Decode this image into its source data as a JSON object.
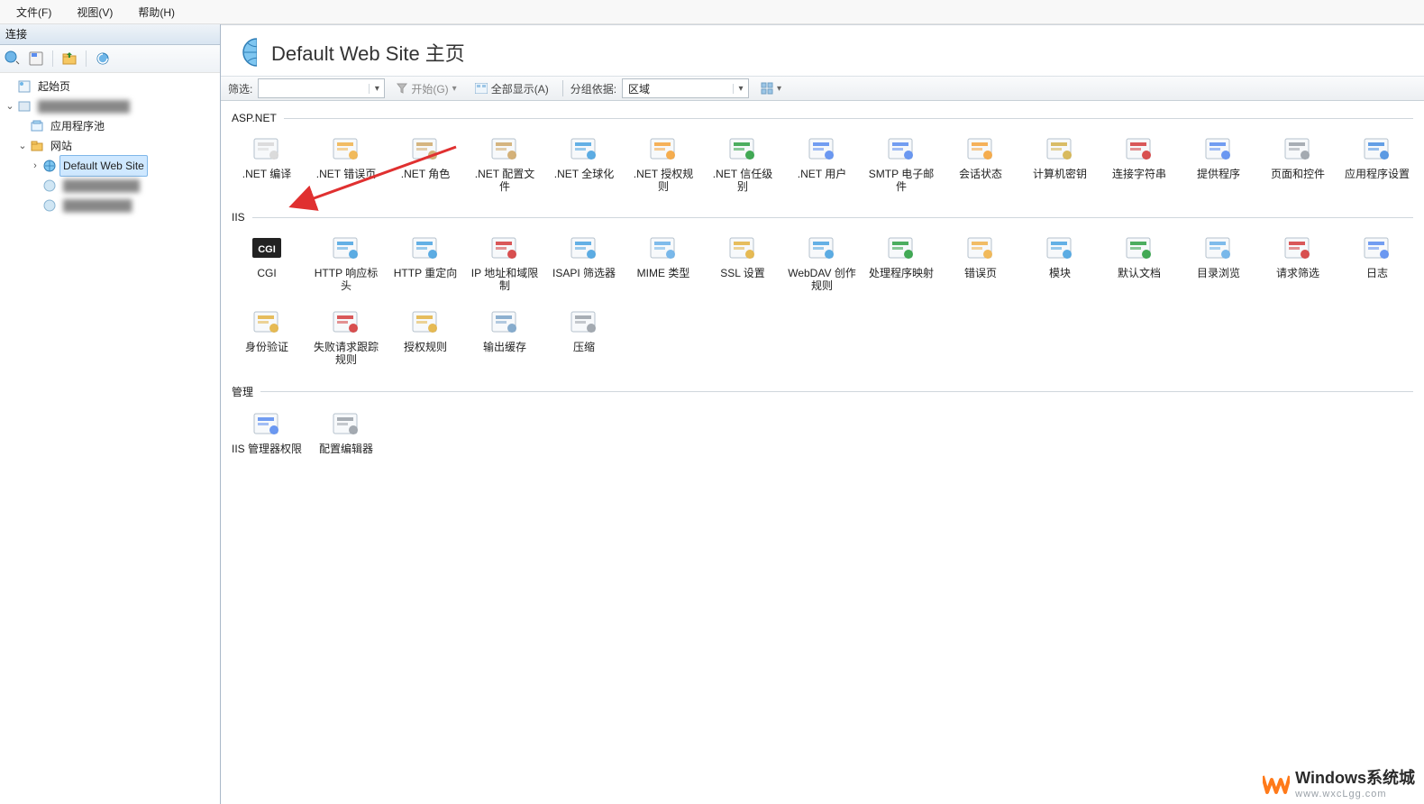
{
  "menubar": {
    "file": "文件(F)",
    "view": "视图(V)",
    "help": "帮助(H)"
  },
  "sidebar": {
    "title": "连接",
    "nodes": {
      "home": "起始页",
      "server": "████████████",
      "apppools": "应用程序池",
      "sites": "网站",
      "default_site": "Default Web Site",
      "sub1": "██████████",
      "sub2": "█████████"
    }
  },
  "page": {
    "title": "Default Web Site 主页"
  },
  "filterbar": {
    "filter_label": "筛选:",
    "go": "开始(G)",
    "showall": "全部显示(A)",
    "groupby_label": "分组依据:",
    "groupby_value": "区域"
  },
  "groups": {
    "aspnet": "ASP.NET",
    "iis": "IIS",
    "mgmt": "管理"
  },
  "aspnet_items": [
    ".NET 编译",
    ".NET 错误页",
    ".NET 角色",
    ".NET 配置文件",
    ".NET 全球化",
    ".NET 授权规则",
    ".NET 信任级别",
    ".NET 用户",
    "SMTP 电子邮件",
    "会话状态",
    "计算机密钥",
    "连接字符串",
    "提供程序",
    "页面和控件",
    "应用程序设置"
  ],
  "iis_items": [
    "CGI",
    "HTTP 响应标头",
    "HTTP 重定向",
    "IP 地址和域限制",
    "ISAPI 筛选器",
    "MIME 类型",
    "SSL 设置",
    "WebDAV 创作规则",
    "处理程序映射",
    "错误页",
    "模块",
    "默认文档",
    "目录浏览",
    "请求筛选",
    "日志",
    "身份验证",
    "失败请求跟踪规则",
    "授权规则",
    "输出缓存",
    "压缩"
  ],
  "mgmt_items": [
    "IIS 管理器权限",
    "配置编辑器"
  ],
  "icon_colors": {
    "aspnet": [
      "#d7d7d7",
      "#f0b24a",
      "#cfa96a",
      "#cfa96a",
      "#4aa3e0",
      "#f4a43c",
      "#2ea043",
      "#5b8def",
      "#5b8def",
      "#f4a43c",
      "#d4b24b",
      "#d43c3c",
      "#5b8def",
      "#9aa1a8",
      "#4a8fe0"
    ],
    "iis": [
      "#222",
      "#4aa3e0",
      "#4aa3e0",
      "#d43c3c",
      "#4aa3e0",
      "#6ab0e8",
      "#e3b341",
      "#4aa3e0",
      "#2ea043",
      "#f0b24a",
      "#4aa3e0",
      "#2ea043",
      "#6ab0e8",
      "#d43c3c",
      "#5b8def",
      "#e3b341",
      "#d43c3c",
      "#e3b341",
      "#7aa3c8",
      "#9aa1a8"
    ],
    "mgmt": [
      "#5b8def",
      "#9aa1a8"
    ]
  },
  "watermark": {
    "title": "Windows系统城",
    "url": "www.wxcLgg.com"
  }
}
